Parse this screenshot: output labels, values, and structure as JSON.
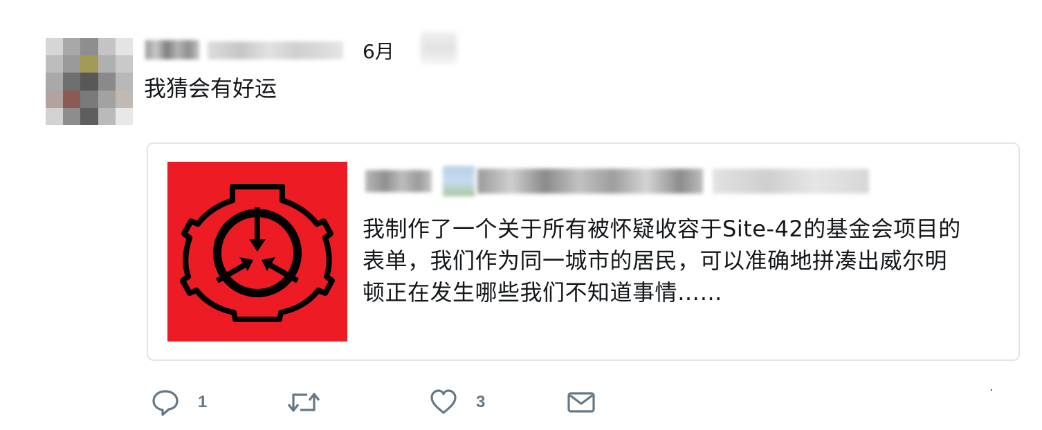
{
  "tweet": {
    "date": "6月",
    "text": "我猜会有好运"
  },
  "quoted": {
    "text_lines": [
      "我制作了一个关于所有被怀疑收容于Site-42的基金会项目的",
      "表单，我们作为同一城市的居民，可以准确地拼凑出威尔明",
      "顿正在发生哪些我们不知道事情……"
    ],
    "thumbnail_icon": "scp-foundation-logo-icon",
    "thumbnail_color": "#ed1c24"
  },
  "actions": {
    "reply_count": "1",
    "retweet_count": "",
    "like_count": "3"
  },
  "icons": {
    "reply": "reply-icon",
    "retweet": "retweet-icon",
    "like": "heart-icon",
    "dm": "envelope-icon"
  },
  "colors": {
    "action_gray": "#657786",
    "card_border": "#dfe5ea",
    "text": "#14171a"
  }
}
